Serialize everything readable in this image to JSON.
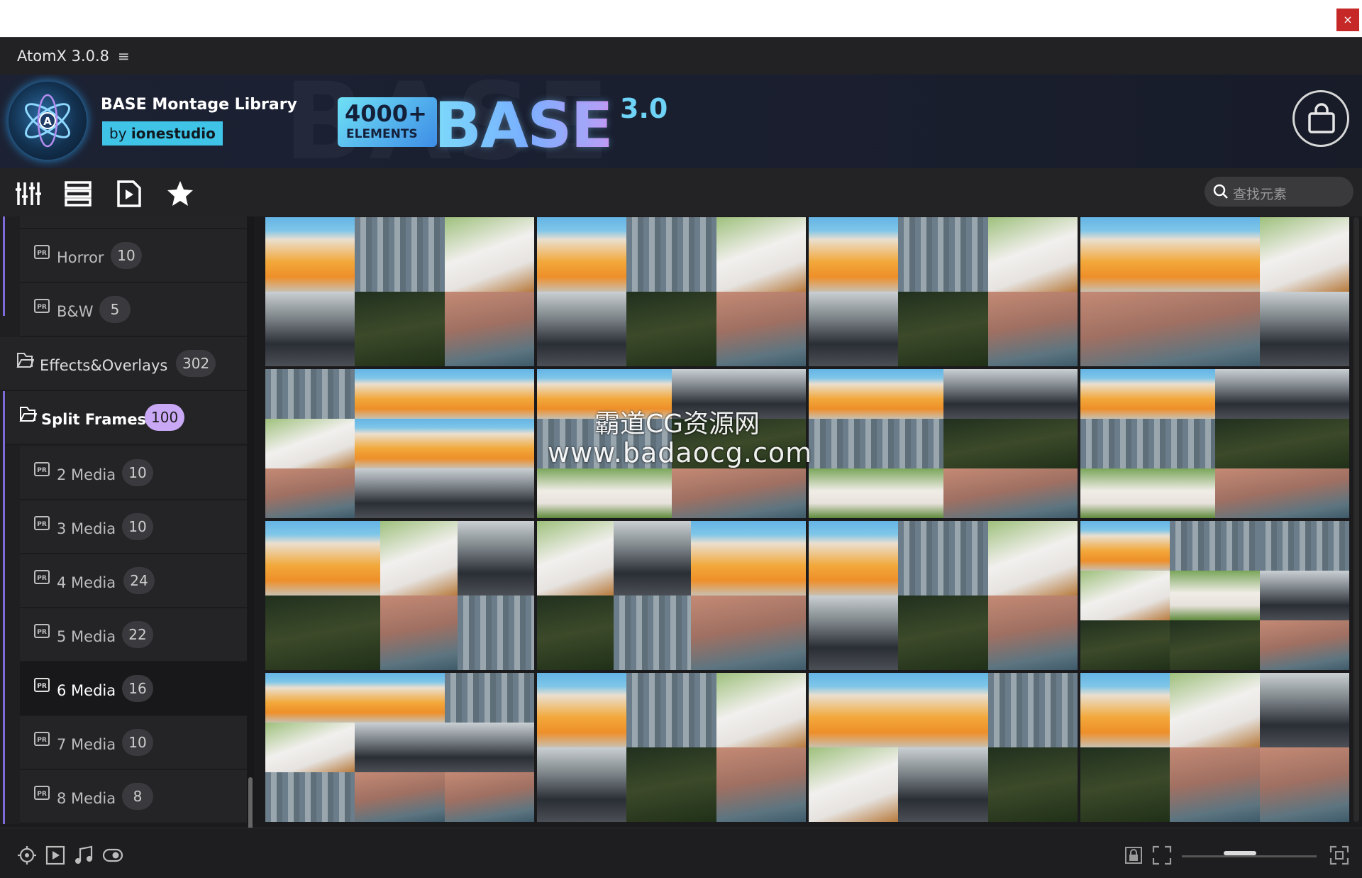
{
  "window": {
    "close_label": "×"
  },
  "app": {
    "title": "AtomX 3.0.8",
    "menu_icon": "≡"
  },
  "header": {
    "library_title": "BASE Montage Library",
    "author_prefix": "by",
    "author_name": "ionestudio",
    "banner_count": "4000+",
    "banner_elements": "ELEMENTS",
    "banner_word": "BASE",
    "banner_version": "3.0",
    "accent_color": "#3fc4e8"
  },
  "toolbar": {
    "icons": [
      "sliders-icon",
      "list-icon",
      "media-play-icon",
      "star-icon"
    ],
    "search_placeholder": "查找元素"
  },
  "sidebar": {
    "items": [
      {
        "label": "Horror",
        "count": "10",
        "level": "sub"
      },
      {
        "label": "B&W",
        "count": "5",
        "level": "sub"
      },
      {
        "label": "Effects&Overlays",
        "count": "302",
        "level": "top"
      },
      {
        "label": "Split Frames",
        "count": "100",
        "level": "top",
        "highlight": true
      },
      {
        "label": "2 Media",
        "count": "10",
        "level": "sub"
      },
      {
        "label": "3 Media",
        "count": "10",
        "level": "sub"
      },
      {
        "label": "4 Media",
        "count": "24",
        "level": "sub"
      },
      {
        "label": "5 Media",
        "count": "22",
        "level": "sub"
      },
      {
        "label": "6 Media",
        "count": "16",
        "level": "sub",
        "selected": true
      },
      {
        "label": "7 Media",
        "count": "10",
        "level": "sub"
      },
      {
        "label": "8 Media",
        "count": "8",
        "level": "sub"
      }
    ],
    "badge_highlight_color": "#c9a8f5"
  },
  "watermark": {
    "line1": "霸道CG资源网",
    "line2": "www.badaocg.com"
  },
  "statusbar": {
    "left_icons": [
      "plugin-icon",
      "video-icon",
      "music-icon",
      "toggle-icon"
    ],
    "right_icons": [
      "lock-icon",
      "fullscreen-icon",
      "expand-icon"
    ]
  }
}
